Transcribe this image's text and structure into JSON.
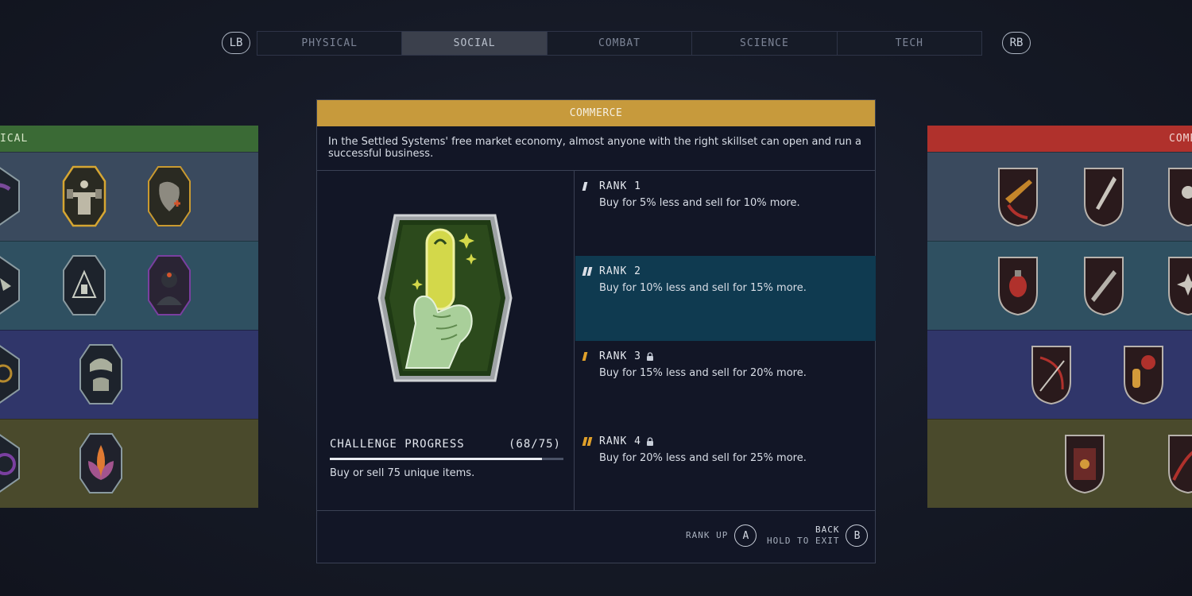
{
  "bumpers": {
    "left": "LB",
    "right": "RB"
  },
  "tabs": [
    {
      "label": "PHYSICAL",
      "active": false
    },
    {
      "label": "SOCIAL",
      "active": true
    },
    {
      "label": "COMBAT",
      "active": false
    },
    {
      "label": "SCIENCE",
      "active": false
    },
    {
      "label": "TECH",
      "active": false
    }
  ],
  "left_panel": {
    "header": "ICAL",
    "color": "#3a6a35"
  },
  "right_panel": {
    "header": "COMB",
    "color": "#b0312c"
  },
  "skill": {
    "title": "COMMERCE",
    "description": "In the Settled Systems' free market economy, almost anyone with the right skillset can open and run a successful business.",
    "icon": "hand-holding-credit-stick-icon"
  },
  "challenge": {
    "label": "CHALLENGE PROGRESS",
    "count": "(68/75)",
    "current": 68,
    "total": 75,
    "description": "Buy or sell 75 unique items."
  },
  "ranks": [
    {
      "title": "RANK 1",
      "text": "Buy for 5% less and sell for 10% more.",
      "locked": false,
      "current": false,
      "marks": 1,
      "mark_color": "#d9dde5"
    },
    {
      "title": "RANK 2",
      "text": "Buy for 10% less and sell for 15% more.",
      "locked": false,
      "current": true,
      "marks": 2,
      "mark_color": "#d9dde5"
    },
    {
      "title": "RANK 3",
      "text": "Buy for 15% less and sell for 20% more.",
      "locked": true,
      "current": false,
      "marks": 1,
      "mark_color": "#e0a02a"
    },
    {
      "title": "RANK 4",
      "text": "Buy for 20% less and sell for 25% more.",
      "locked": true,
      "current": false,
      "marks": 2,
      "mark_color": "#e0a02a"
    }
  ],
  "footer": {
    "rank_up_label": "RANK UP",
    "rank_up_button": "A",
    "back_label": "BACK",
    "hold_label": "HOLD TO EXIT",
    "back_button": "B"
  }
}
